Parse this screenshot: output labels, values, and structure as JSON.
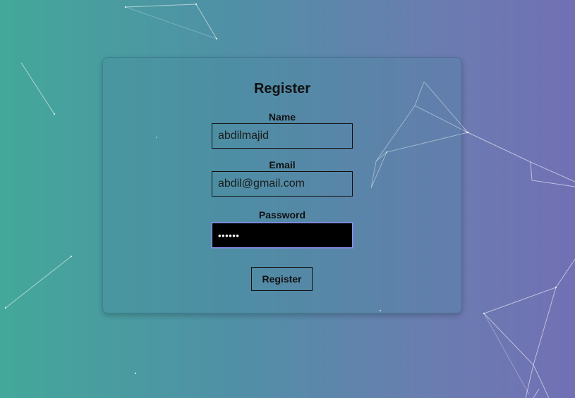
{
  "form": {
    "title": "Register",
    "name_label": "Name",
    "name_value": "abdilmajid",
    "email_label": "Email",
    "email_value": "abdil@gmail.com",
    "password_label": "Password",
    "password_value": "••••••",
    "submit_label": "Register"
  },
  "colors": {
    "gradient_start": "#43a89a",
    "gradient_end": "#7170b5",
    "focus_border": "#8d8df0"
  }
}
